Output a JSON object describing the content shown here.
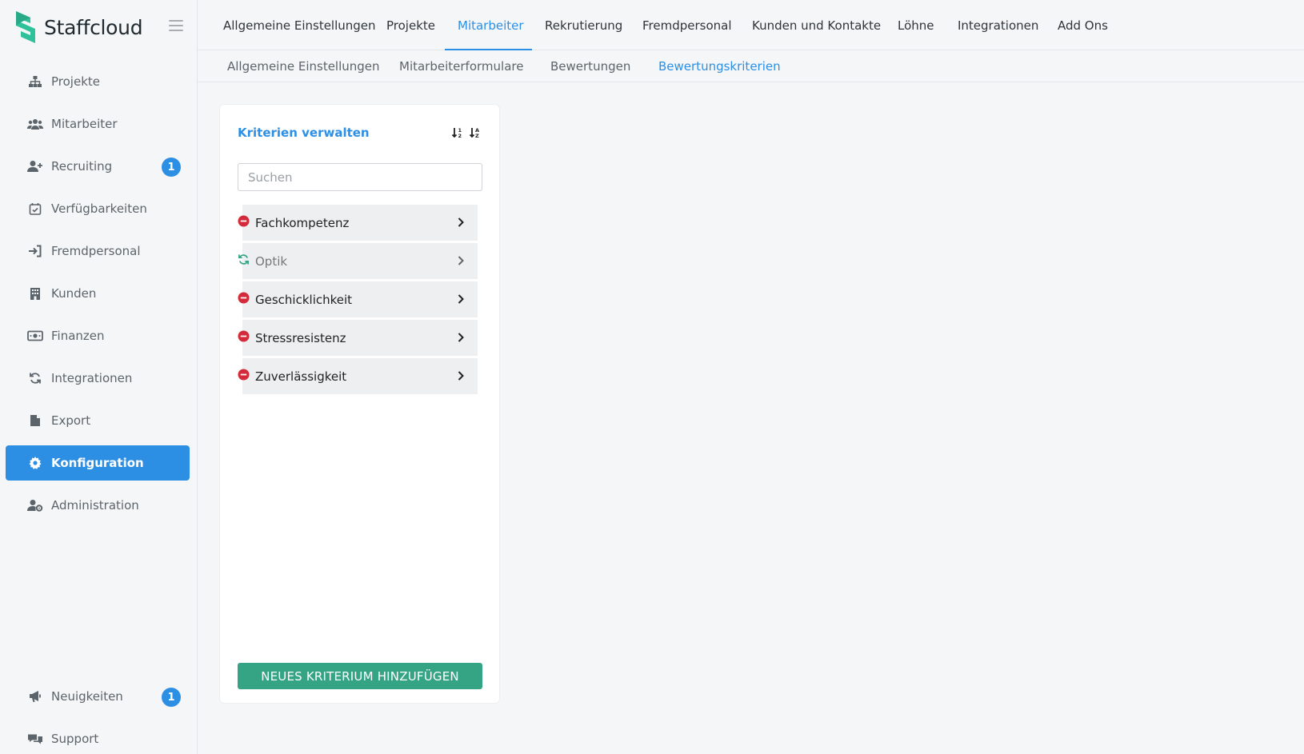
{
  "app": {
    "name": "Staffcloud"
  },
  "sidebar": {
    "items": [
      {
        "label": "Projekte",
        "icon": "sitemap-icon"
      },
      {
        "label": "Mitarbeiter",
        "icon": "users-icon"
      },
      {
        "label": "Recruiting",
        "icon": "user-plus-icon",
        "badge": "1"
      },
      {
        "label": "Verfügbarkeiten",
        "icon": "calendar-check-icon"
      },
      {
        "label": "Fremdpersonal",
        "icon": "sign-in-icon"
      },
      {
        "label": "Kunden",
        "icon": "building-icon"
      },
      {
        "label": "Finanzen",
        "icon": "money-bill-icon"
      },
      {
        "label": "Integrationen",
        "icon": "sync-icon"
      },
      {
        "label": "Export",
        "icon": "file-icon"
      },
      {
        "label": "Konfiguration",
        "icon": "gear-icon",
        "active": true
      },
      {
        "label": "Administration",
        "icon": "user-cog-icon"
      }
    ],
    "bottom": [
      {
        "label": "Neuigkeiten",
        "icon": "bullhorn-icon",
        "badge": "1"
      },
      {
        "label": "Support",
        "icon": "comments-icon"
      }
    ]
  },
  "topnav": {
    "tabs": [
      {
        "label": "Allgemeine Einstellungen"
      },
      {
        "label": "Projekte"
      },
      {
        "label": "Mitarbeiter",
        "active": true
      },
      {
        "label": "Rekrutierung"
      },
      {
        "label": "Fremdpersonal"
      },
      {
        "label": "Kunden und Kontakte"
      },
      {
        "label": "Löhne"
      },
      {
        "label": "Integrationen"
      },
      {
        "label": "Add Ons"
      }
    ]
  },
  "subnav": {
    "tabs": [
      {
        "label": "Allgemeine Einstellungen"
      },
      {
        "label": "Mitarbeiterformulare"
      },
      {
        "label": "Bewertungen"
      },
      {
        "label": "Bewertungskriterien",
        "active": true
      }
    ]
  },
  "panel": {
    "title": "Kriterien verwalten",
    "search_placeholder": "Suchen",
    "search_value": "",
    "items": [
      {
        "label": "Fachkompetenz",
        "status": "remove"
      },
      {
        "label": "Optik",
        "status": "restore"
      },
      {
        "label": "Geschicklichkeit",
        "status": "remove"
      },
      {
        "label": "Stressresistenz",
        "status": "remove"
      },
      {
        "label": "Zuverlässigkeit",
        "status": "remove"
      }
    ],
    "add_button": "NEUES KRITERIUM HINZUFÜGEN"
  },
  "colors": {
    "accent": "#2d8fe4",
    "button": "#34a485",
    "remove": "#d32b3b",
    "restore": "#34a485",
    "logo": "#2fc29a"
  }
}
